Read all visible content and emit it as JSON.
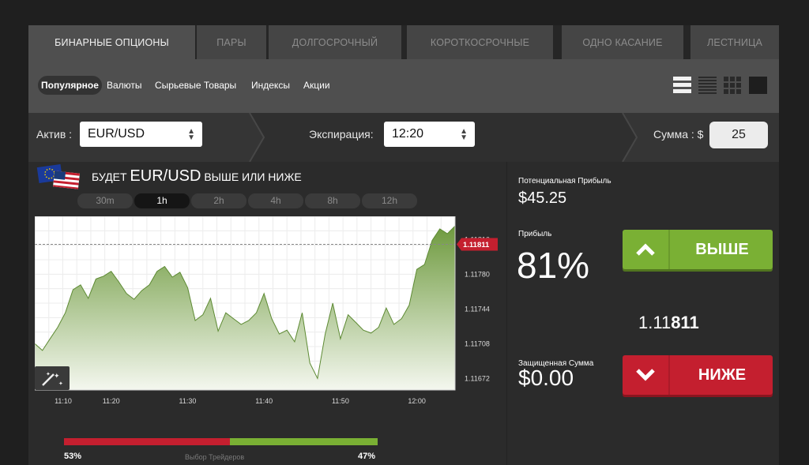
{
  "tabs": [
    "БИНАРНЫЕ ОПЦИОНЫ",
    "ПАРЫ",
    "ДОЛГОСРОЧНЫЙ",
    "КОРОТКОСРОЧНЫЕ",
    "ОДНО КАСАНИЕ",
    "ЛЕСТНИЦА"
  ],
  "subnav": [
    "Популярное",
    "Валюты",
    "Сырьевые Товары",
    "Индексы",
    "Акции"
  ],
  "asset": {
    "label": "Актив :",
    "value": "EUR/USD"
  },
  "expiration": {
    "label": "Экспирация:",
    "value": "12:20"
  },
  "amount": {
    "label": "Сумма : $",
    "value": "25"
  },
  "headline": {
    "prefix": "БУДЕТ",
    "pair": "EUR/USD",
    "suffix": "ВЫШЕ ИЛИ НИЖЕ"
  },
  "timeframes": [
    "30m",
    "1h",
    "2h",
    "4h",
    "8h",
    "12h"
  ],
  "active_timeframe": "1h",
  "traders": {
    "sell_pct": "53%",
    "buy_pct": "47%",
    "sell_value": 53,
    "buy_value": 47,
    "label": "Выбор Трейдеров"
  },
  "right_panel": {
    "potential_label": "Потенциальная Прибыль",
    "potential_value": "$45.25",
    "profit_label": "Прибыль",
    "profit_value": "81%",
    "protected_label": "Защищенная Сумма",
    "protected_value": "$0.00",
    "up_label": "ВЫШЕ",
    "down_label": "НИЖЕ",
    "price_main": "1.11",
    "price_bold": "811"
  },
  "colors": {
    "up": "#7ab034",
    "down": "#c41f2f",
    "area": "#6e9a3e"
  },
  "chart_data": {
    "type": "area",
    "x_ticks": [
      "11:10",
      "11:20",
      "11:30",
      "11:40",
      "11:50",
      "12:00"
    ],
    "x_range": [
      "11:10",
      "12:05"
    ],
    "y_ticks": [
      "1.11816",
      "1.11780",
      "1.11744",
      "1.11708",
      "1.11672"
    ],
    "ylim": [
      1.1166,
      1.1184
    ],
    "current": "1.11811",
    "current_value": 1.11811,
    "x": [
      0,
      1,
      2,
      3,
      4,
      5,
      6,
      7,
      8,
      9,
      10,
      11,
      12,
      13,
      14,
      15,
      16,
      17,
      18,
      19,
      20,
      21,
      22,
      23,
      24,
      25,
      26,
      27,
      28,
      29,
      30,
      31,
      32,
      33,
      34,
      35,
      36,
      37,
      38,
      39,
      40,
      41,
      42,
      43,
      44,
      45,
      46,
      47,
      48,
      49,
      50,
      51,
      52,
      53,
      54,
      55
    ],
    "y": [
      1.11708,
      1.11701,
      1.11713,
      1.11725,
      1.1174,
      1.11764,
      1.11769,
      1.11755,
      1.11775,
      1.11778,
      1.11783,
      1.11772,
      1.1176,
      1.11754,
      1.11763,
      1.11769,
      1.11783,
      1.11788,
      1.11777,
      1.11782,
      1.11766,
      1.11732,
      1.11738,
      1.11755,
      1.11721,
      1.1174,
      1.11734,
      1.11728,
      1.11732,
      1.1174,
      1.1176,
      1.11734,
      1.11718,
      1.11722,
      1.1171,
      1.1174,
      1.11688,
      1.11672,
      1.11718,
      1.1175,
      1.11713,
      1.11738,
      1.1173,
      1.11722,
      1.11719,
      1.11725,
      1.11745,
      1.11728,
      1.11734,
      1.11748,
      1.11785,
      1.1179,
      1.11815,
      1.11827,
      1.11822,
      1.1183
    ]
  }
}
